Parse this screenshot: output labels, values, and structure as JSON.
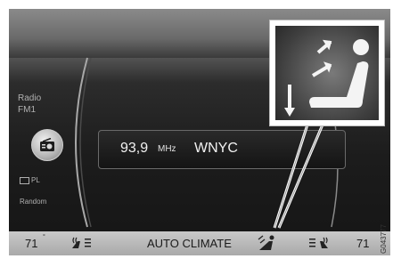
{
  "left_panel": {
    "source_title": "Radio",
    "band": "FM1",
    "pl_label": "PL",
    "random_label": "Random"
  },
  "station": {
    "frequency": "93,9",
    "unit": "MHz",
    "name": "WNYC"
  },
  "climate_bar": {
    "temp_left": "71",
    "temp_left_degree": "°",
    "mode_label": "AUTO CLIMATE",
    "temp_right": "71"
  },
  "image_code": "G043777",
  "icons": [
    "radio-icon",
    "pl-icon",
    "seat-heat-left-icon",
    "airflow-icon",
    "seat-heat-right-icon",
    "airflow-zoom-icon"
  ]
}
